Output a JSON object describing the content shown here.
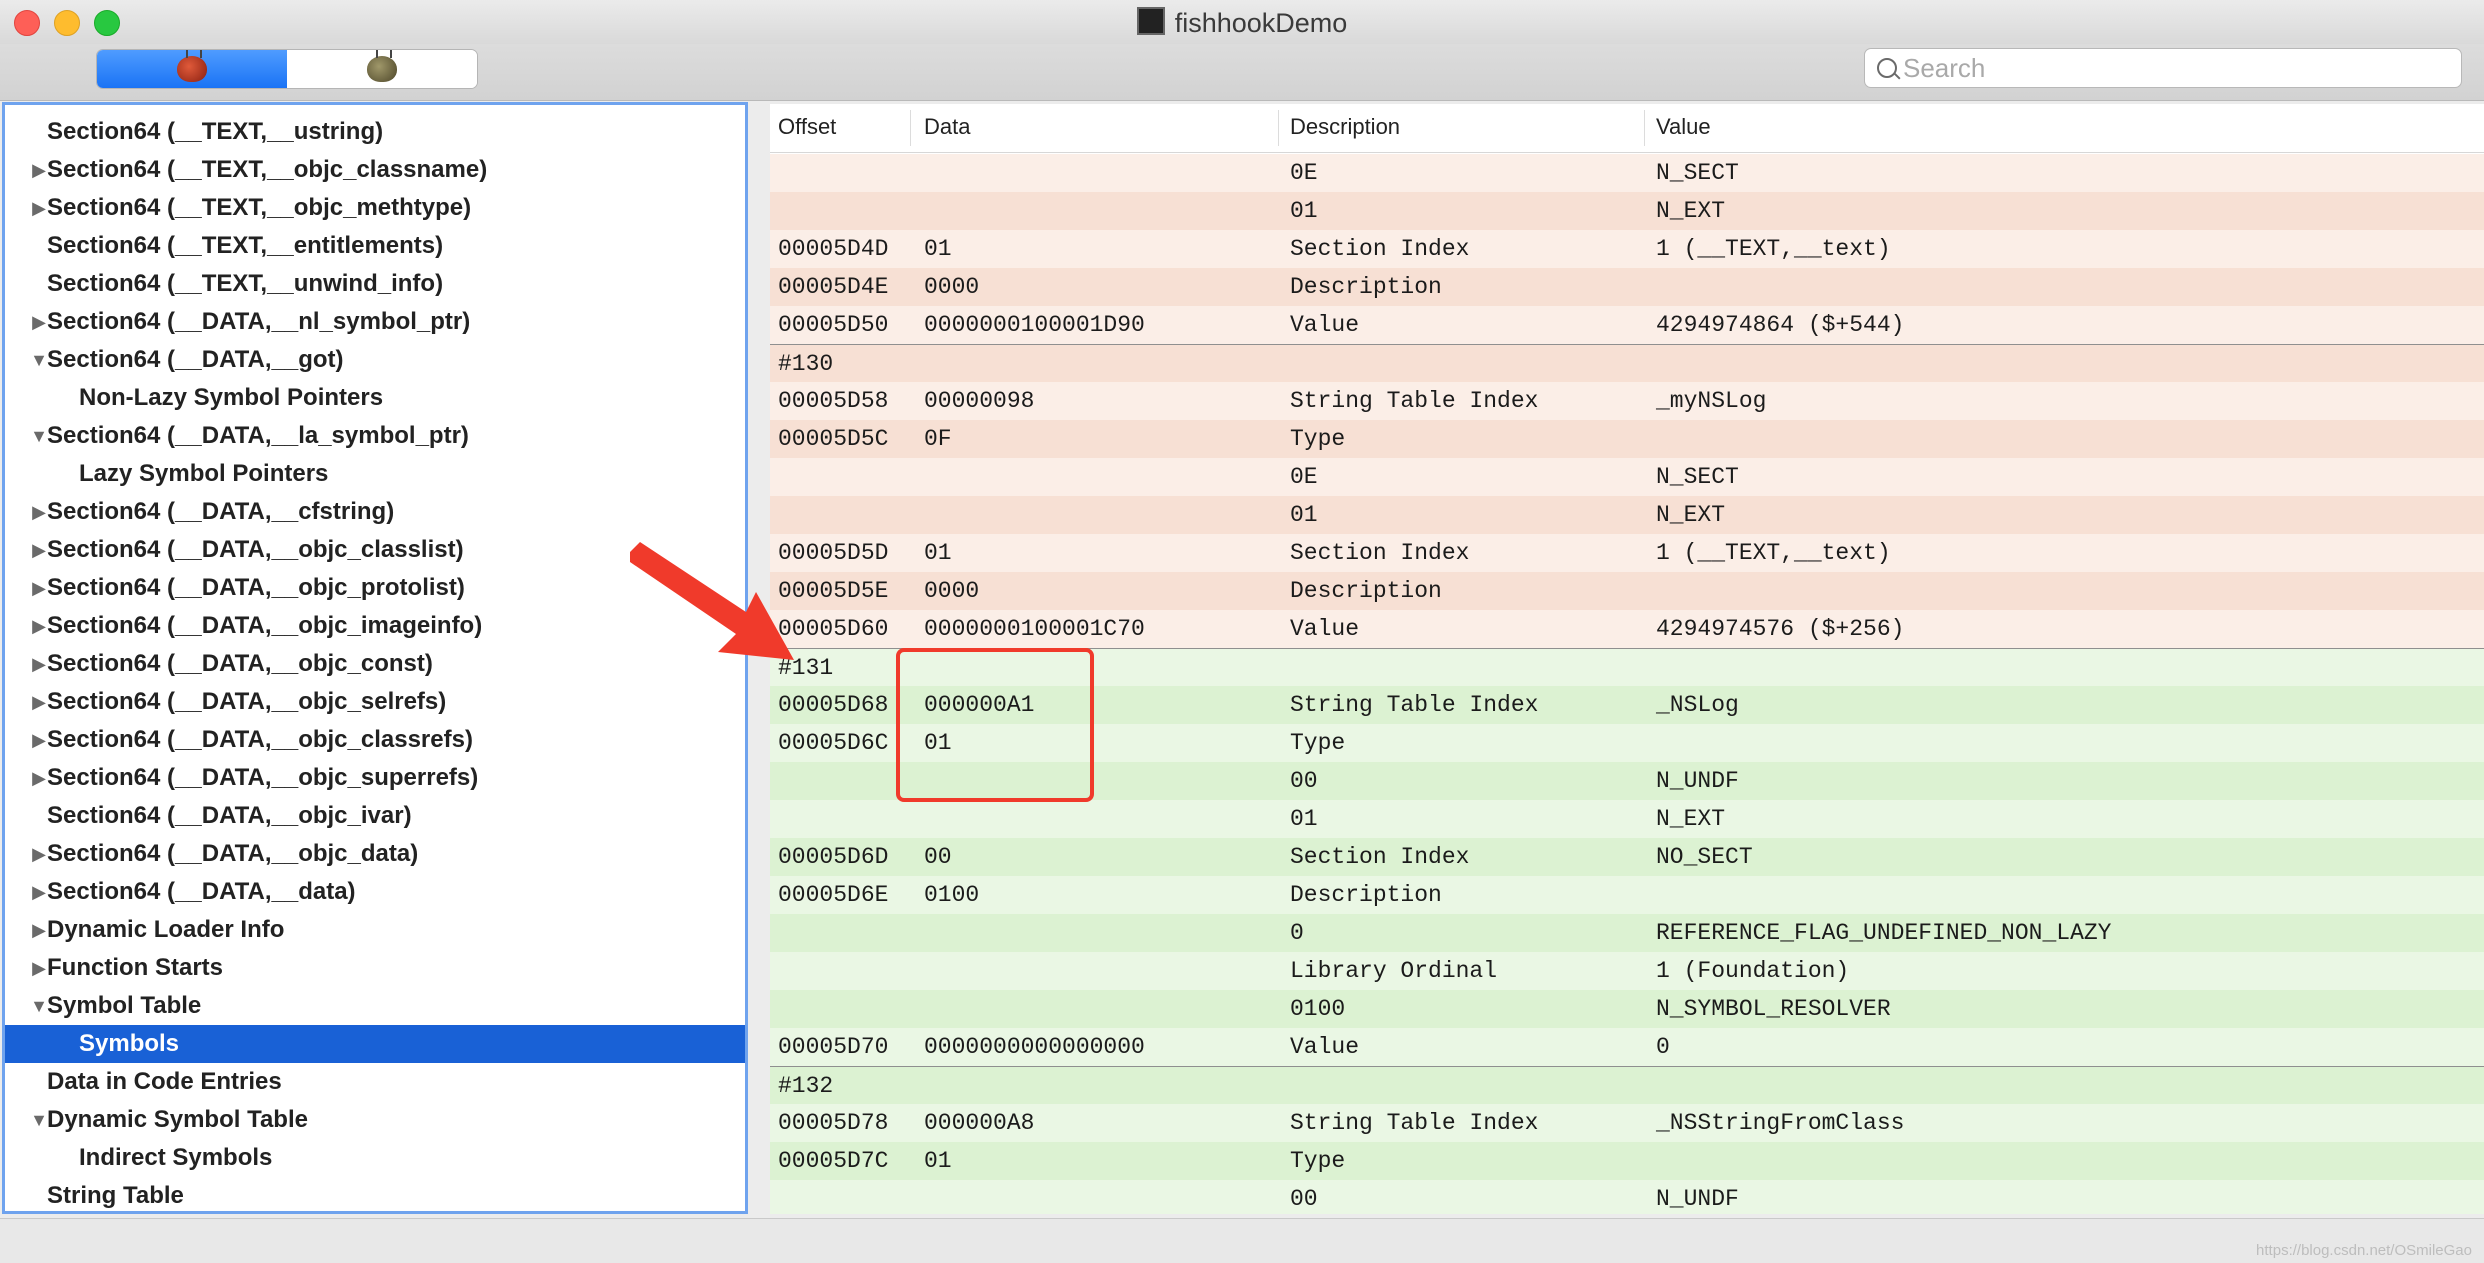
{
  "window": {
    "title": "fishhookDemo"
  },
  "search": {
    "placeholder": "Search"
  },
  "sidebar": {
    "items": [
      {
        "label": "Section64 (__TEXT,__ustring)",
        "level": 0,
        "disclosure": "none"
      },
      {
        "label": "Section64 (__TEXT,__objc_classname)",
        "level": 0,
        "disclosure": "collapsed"
      },
      {
        "label": "Section64 (__TEXT,__objc_methtype)",
        "level": 0,
        "disclosure": "collapsed"
      },
      {
        "label": "Section64 (__TEXT,__entitlements)",
        "level": 0,
        "disclosure": "none"
      },
      {
        "label": "Section64 (__TEXT,__unwind_info)",
        "level": 0,
        "disclosure": "none"
      },
      {
        "label": "Section64 (__DATA,__nl_symbol_ptr)",
        "level": 0,
        "disclosure": "collapsed"
      },
      {
        "label": "Section64 (__DATA,__got)",
        "level": 0,
        "disclosure": "expanded"
      },
      {
        "label": "Non-Lazy Symbol Pointers",
        "level": 1,
        "disclosure": "none"
      },
      {
        "label": "Section64 (__DATA,__la_symbol_ptr)",
        "level": 0,
        "disclosure": "expanded"
      },
      {
        "label": "Lazy Symbol Pointers",
        "level": 1,
        "disclosure": "none"
      },
      {
        "label": "Section64 (__DATA,__cfstring)",
        "level": 0,
        "disclosure": "collapsed"
      },
      {
        "label": "Section64 (__DATA,__objc_classlist)",
        "level": 0,
        "disclosure": "collapsed"
      },
      {
        "label": "Section64 (__DATA,__objc_protolist)",
        "level": 0,
        "disclosure": "collapsed"
      },
      {
        "label": "Section64 (__DATA,__objc_imageinfo)",
        "level": 0,
        "disclosure": "collapsed"
      },
      {
        "label": "Section64 (__DATA,__objc_const)",
        "level": 0,
        "disclosure": "collapsed"
      },
      {
        "label": "Section64 (__DATA,__objc_selrefs)",
        "level": 0,
        "disclosure": "collapsed"
      },
      {
        "label": "Section64 (__DATA,__objc_classrefs)",
        "level": 0,
        "disclosure": "collapsed"
      },
      {
        "label": "Section64 (__DATA,__objc_superrefs)",
        "level": 0,
        "disclosure": "collapsed"
      },
      {
        "label": "Section64 (__DATA,__objc_ivar)",
        "level": 0,
        "disclosure": "none"
      },
      {
        "label": "Section64 (__DATA,__objc_data)",
        "level": 0,
        "disclosure": "collapsed"
      },
      {
        "label": "Section64 (__DATA,__data)",
        "level": 0,
        "disclosure": "collapsed"
      },
      {
        "label": "Dynamic Loader Info",
        "level": 0,
        "disclosure": "collapsed"
      },
      {
        "label": "Function Starts",
        "level": 0,
        "disclosure": "collapsed"
      },
      {
        "label": "Symbol Table",
        "level": 0,
        "disclosure": "expanded"
      },
      {
        "label": "Symbols",
        "level": 1,
        "disclosure": "none",
        "selected": true
      },
      {
        "label": "Data in Code Entries",
        "level": 0,
        "disclosure": "none"
      },
      {
        "label": "Dynamic Symbol Table",
        "level": 0,
        "disclosure": "expanded"
      },
      {
        "label": "Indirect Symbols",
        "level": 1,
        "disclosure": "none"
      },
      {
        "label": "String Table",
        "level": 0,
        "disclosure": "none"
      }
    ]
  },
  "table": {
    "columns": [
      "Offset",
      "Data",
      "Description",
      "Value"
    ],
    "rows": [
      {
        "offset": "",
        "data": "",
        "desc": "0E",
        "value": "N_SECT",
        "tone": "peach"
      },
      {
        "offset": "",
        "data": "",
        "desc": "01",
        "value": "N_EXT",
        "tone": "peach"
      },
      {
        "offset": "00005D4D",
        "data": "01",
        "desc": "Section Index",
        "value": "1 (__TEXT,__text)",
        "tone": "peach"
      },
      {
        "offset": "00005D4E",
        "data": "0000",
        "desc": "Description",
        "value": "",
        "tone": "peach"
      },
      {
        "offset": "00005D50",
        "data": "0000000100001D90",
        "desc": "Value",
        "value": "4294974864 ($+544)",
        "tone": "peach"
      },
      {
        "offset": "#130",
        "data": "",
        "desc": "",
        "value": "",
        "tone": "peach",
        "sep": true
      },
      {
        "offset": "00005D58",
        "data": "00000098",
        "desc": "String Table Index",
        "value": "_myNSLog",
        "tone": "peach"
      },
      {
        "offset": "00005D5C",
        "data": "0F",
        "desc": "Type",
        "value": "",
        "tone": "peach"
      },
      {
        "offset": "",
        "data": "",
        "desc": "0E",
        "value": "N_SECT",
        "tone": "peach"
      },
      {
        "offset": "",
        "data": "",
        "desc": "01",
        "value": "N_EXT",
        "tone": "peach"
      },
      {
        "offset": "00005D5D",
        "data": "01",
        "desc": "Section Index",
        "value": "1 (__TEXT,__text)",
        "tone": "peach"
      },
      {
        "offset": "00005D5E",
        "data": "0000",
        "desc": "Description",
        "value": "",
        "tone": "peach"
      },
      {
        "offset": "00005D60",
        "data": "0000000100001C70",
        "desc": "Value",
        "value": "4294974576 ($+256)",
        "tone": "peach"
      },
      {
        "offset": "#131",
        "data": "",
        "desc": "",
        "value": "",
        "tone": "green",
        "sep": true
      },
      {
        "offset": "00005D68",
        "data": "000000A1",
        "desc": "String Table Index",
        "value": "_NSLog",
        "tone": "green"
      },
      {
        "offset": "00005D6C",
        "data": "01",
        "desc": "Type",
        "value": "",
        "tone": "green"
      },
      {
        "offset": "",
        "data": "",
        "desc": "00",
        "value": "N_UNDF",
        "tone": "green"
      },
      {
        "offset": "",
        "data": "",
        "desc": "01",
        "value": "N_EXT",
        "tone": "green"
      },
      {
        "offset": "00005D6D",
        "data": "00",
        "desc": "Section Index",
        "value": "NO_SECT",
        "tone": "green"
      },
      {
        "offset": "00005D6E",
        "data": "0100",
        "desc": "Description",
        "value": "",
        "tone": "green"
      },
      {
        "offset": "",
        "data": "",
        "desc": "0",
        "value": "REFERENCE_FLAG_UNDEFINED_NON_LAZY",
        "tone": "green"
      },
      {
        "offset": "",
        "data": "",
        "desc": "Library Ordinal",
        "value": "1 (Foundation)",
        "tone": "green"
      },
      {
        "offset": "",
        "data": "",
        "desc": "0100",
        "value": "N_SYMBOL_RESOLVER",
        "tone": "green"
      },
      {
        "offset": "00005D70",
        "data": "0000000000000000",
        "desc": "Value",
        "value": "0",
        "tone": "green"
      },
      {
        "offset": "#132",
        "data": "",
        "desc": "",
        "value": "",
        "tone": "green",
        "sep": true
      },
      {
        "offset": "00005D78",
        "data": "000000A8",
        "desc": "String Table Index",
        "value": "_NSStringFromClass",
        "tone": "green"
      },
      {
        "offset": "00005D7C",
        "data": "01",
        "desc": "Type",
        "value": "",
        "tone": "green"
      },
      {
        "offset": "",
        "data": "",
        "desc": "00",
        "value": "N_UNDF",
        "tone": "green"
      }
    ]
  },
  "watermark": "https://blog.csdn.net/OSmileGao",
  "colors": {
    "selection": "#1961d6",
    "peach_row": "#fbeee7",
    "green_row": "#eaf7e4",
    "annotation_red": "#f03a2b"
  }
}
